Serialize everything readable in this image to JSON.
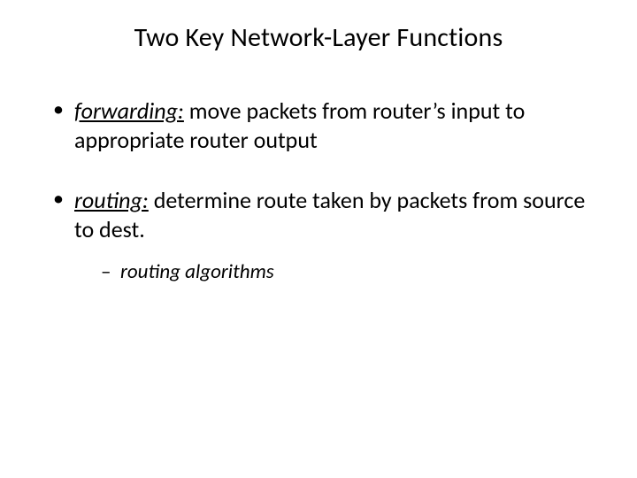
{
  "title": "Two Key Network-Layer Functions",
  "bullets": [
    {
      "term": "forwarding:",
      "rest": " move packets from router’s input to appropriate router output"
    },
    {
      "term": "routing:",
      "rest": " determine route taken by packets from source to dest.",
      "sub": [
        {
          "text": "routing algorithms"
        }
      ]
    }
  ]
}
